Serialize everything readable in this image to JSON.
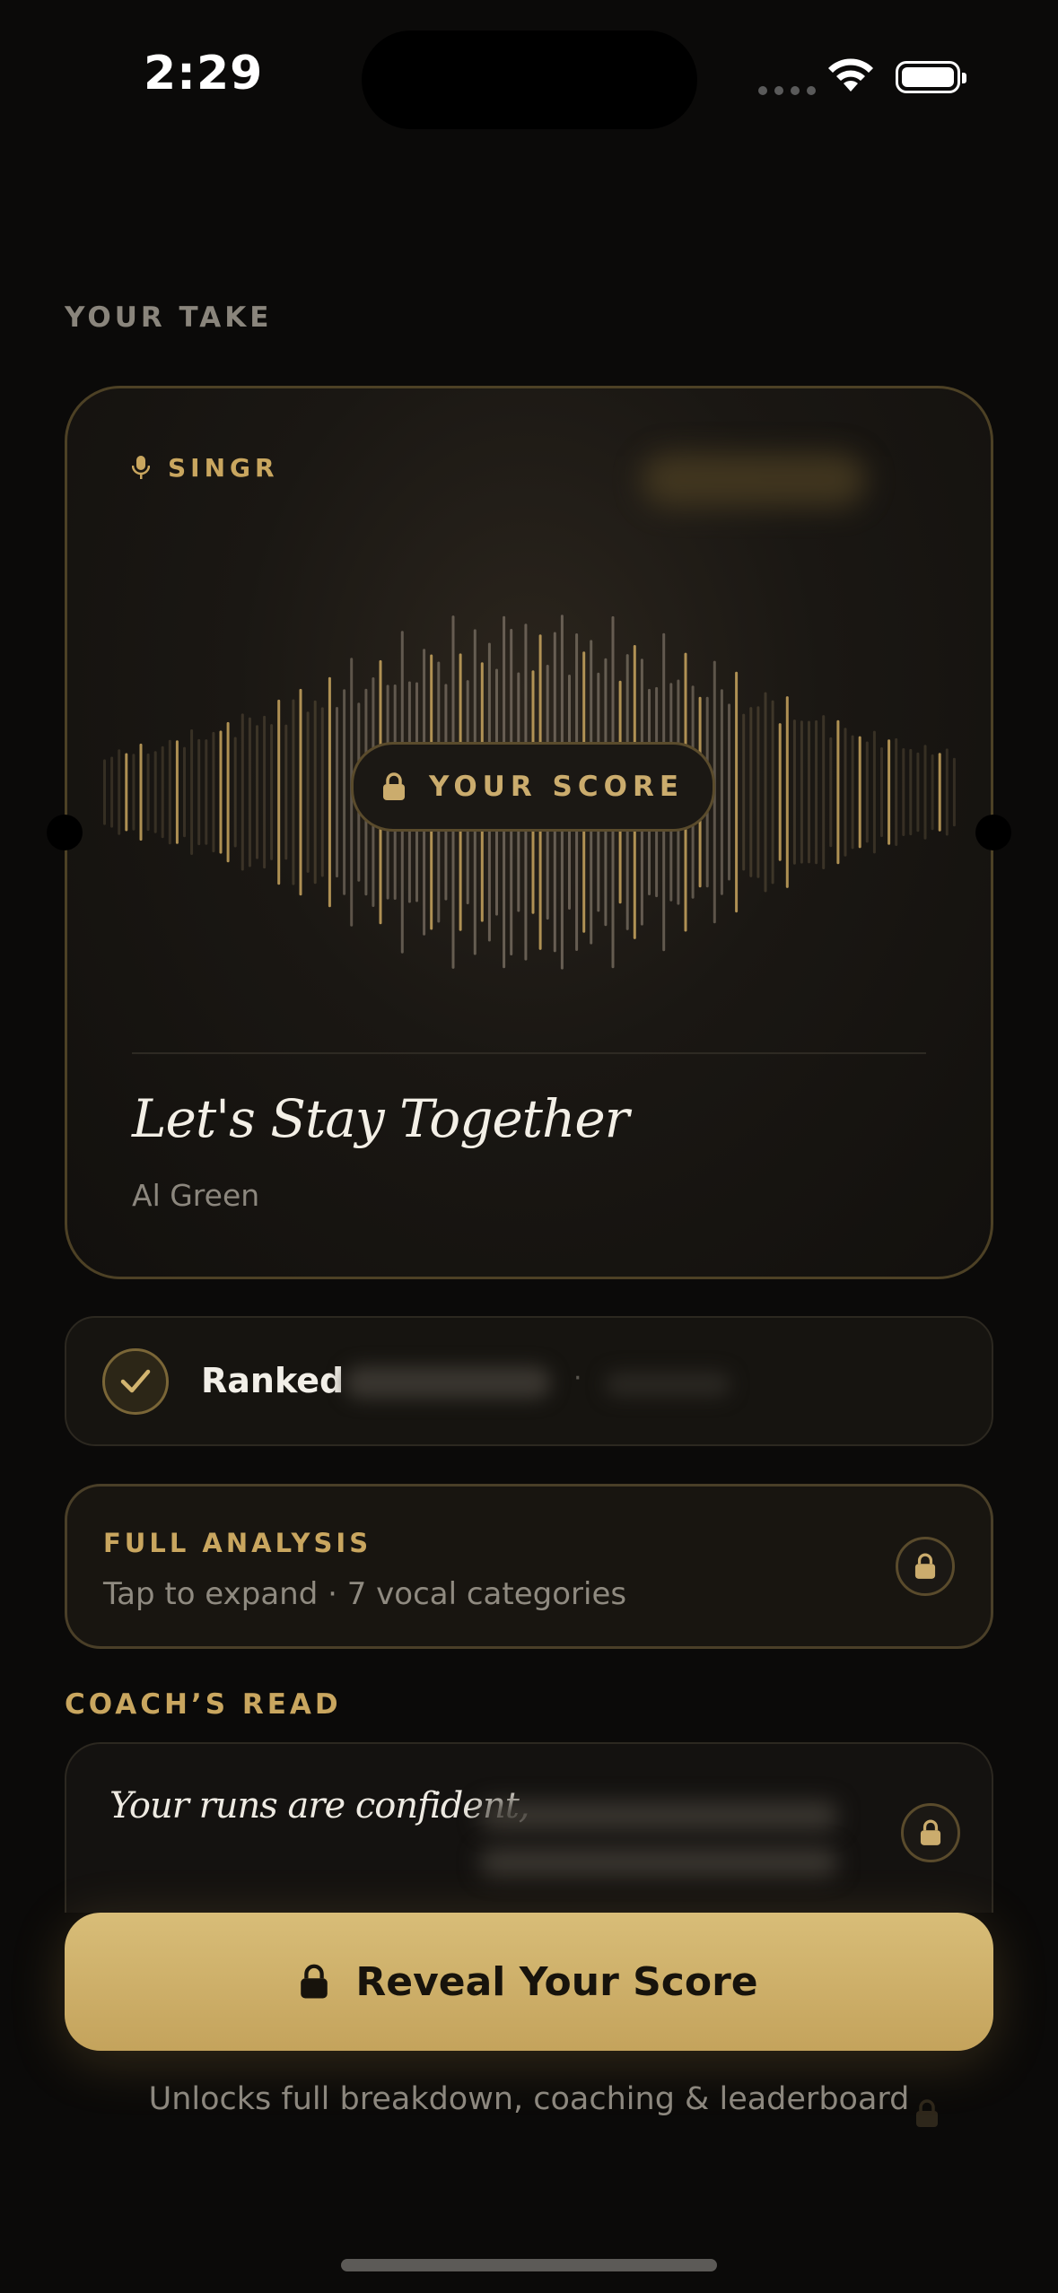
{
  "status_bar": {
    "time": "2:29"
  },
  "section": {
    "your_take": "YOUR TAKE",
    "coach_read": "COACH’S READ"
  },
  "card": {
    "brand": "SINGR",
    "score_pill": "YOUR SCORE",
    "song_title": "Let's Stay Together",
    "artist": "Al Green"
  },
  "ranked": {
    "label": "Ranked",
    "separator": "·"
  },
  "analysis": {
    "title": "FULL ANALYSIS",
    "subtitle": "Tap to expand · 7 vocal categories"
  },
  "coach": {
    "text": "Your runs are confident,"
  },
  "reveal": {
    "label": "Reveal Your Score",
    "caption": "Unlocks full breakdown, coaching & leaderboard"
  },
  "colors": {
    "accent_gold": "#c9a65f",
    "background": "#0b0a09",
    "button_gold": "#d2b46f"
  },
  "icons": [
    "mic-icon",
    "lock-icon",
    "check-icon",
    "wifi-icon",
    "battery-icon"
  ]
}
